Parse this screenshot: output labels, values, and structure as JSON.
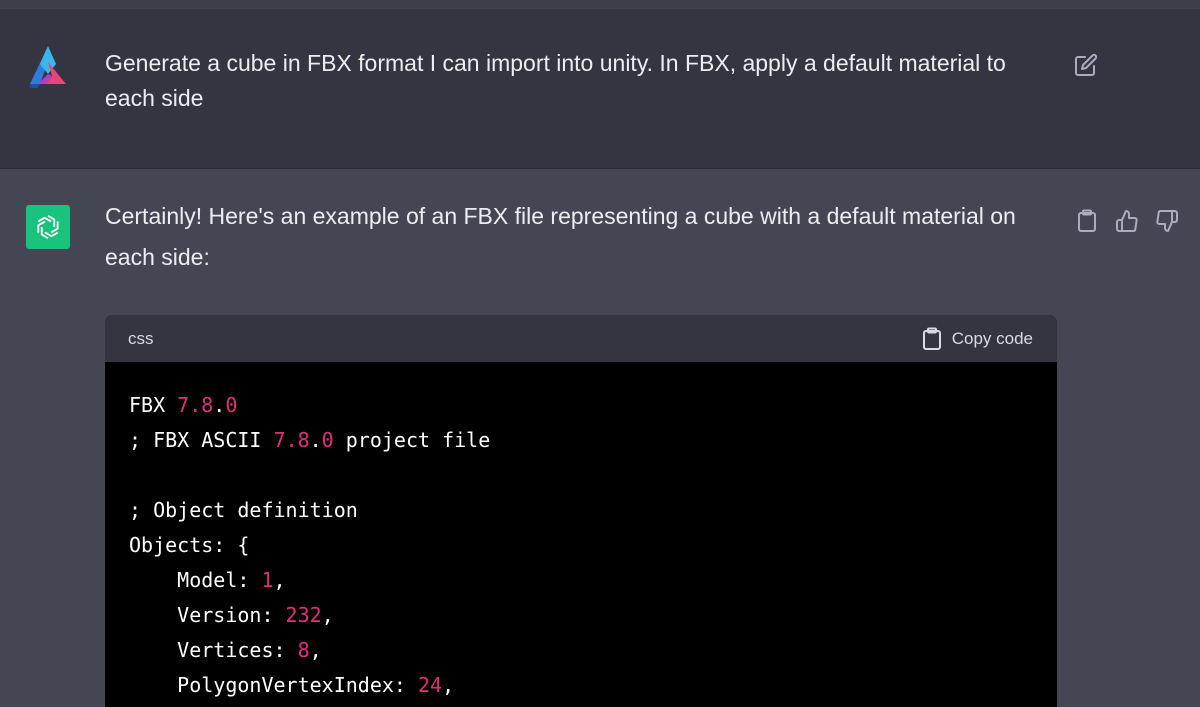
{
  "user_message": {
    "text": "Generate a cube in FBX format I can import into unity. In FBX, apply a default material to each side"
  },
  "assistant_message": {
    "text": "Certainly! Here's an example of an FBX file representing a cube with a default material on each side:"
  },
  "code_block": {
    "language": "css",
    "copy_label": "Copy code",
    "lines": [
      [
        {
          "t": "FBX "
        },
        {
          "t": "7.8",
          "c": "num"
        },
        {
          "t": "."
        },
        {
          "t": "0",
          "c": "num"
        }
      ],
      [
        {
          "t": "; FBX ASCII "
        },
        {
          "t": "7.8",
          "c": "num"
        },
        {
          "t": "."
        },
        {
          "t": "0",
          "c": "num"
        },
        {
          "t": " project file"
        }
      ],
      [],
      [
        {
          "t": "; Object definition"
        }
      ],
      [
        {
          "t": "Objects: {"
        }
      ],
      [
        {
          "t": "    Model: "
        },
        {
          "t": "1",
          "c": "num"
        },
        {
          "t": ","
        }
      ],
      [
        {
          "t": "    Version: "
        },
        {
          "t": "232",
          "c": "num"
        },
        {
          "t": ","
        }
      ],
      [
        {
          "t": "    Vertices: "
        },
        {
          "t": "8",
          "c": "num"
        },
        {
          "t": ","
        }
      ],
      [
        {
          "t": "    PolygonVertexIndex: "
        },
        {
          "t": "24",
          "c": "num"
        },
        {
          "t": ","
        }
      ]
    ]
  },
  "colors": {
    "background": "#444654",
    "user_row": "#343541",
    "code_bg": "#000000",
    "number": "#df3079",
    "gpt_avatar": "#19c37d"
  }
}
